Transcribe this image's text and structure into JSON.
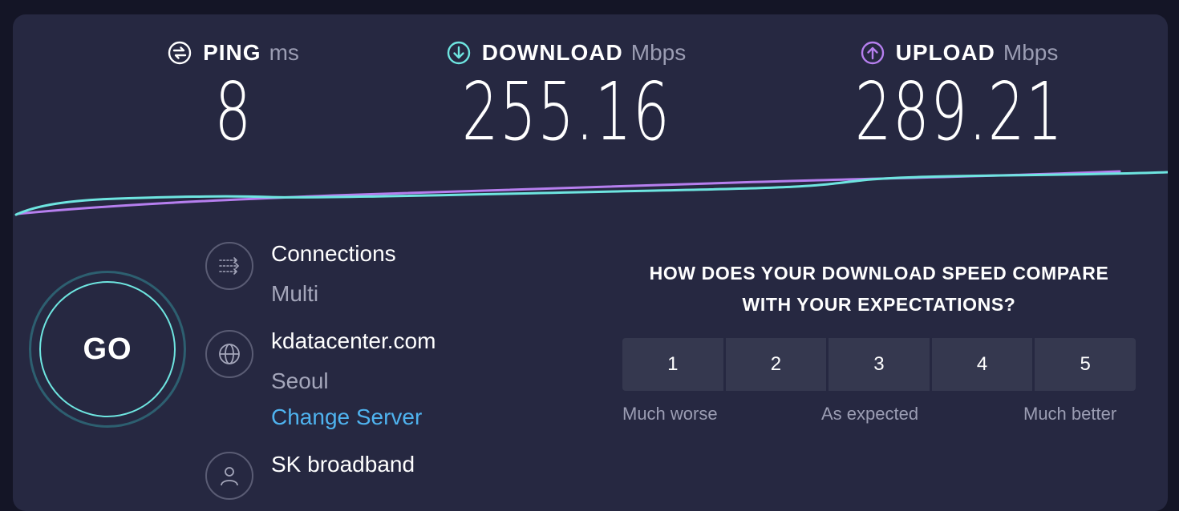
{
  "metrics": {
    "ping": {
      "label": "PING",
      "unit": "ms",
      "value": "8",
      "icon": "ping-icon",
      "color": "#ffffff"
    },
    "download": {
      "label": "DOWNLOAD",
      "unit": "Mbps",
      "value": "255.16",
      "icon": "download-arrow-icon",
      "color": "#6ee5e0"
    },
    "upload": {
      "label": "UPLOAD",
      "unit": "Mbps",
      "value": "289.21",
      "icon": "upload-arrow-icon",
      "color": "#b67fef"
    }
  },
  "go_button": {
    "label": "GO"
  },
  "connections": {
    "title": "Connections",
    "value": "Multi",
    "icon": "connections-icon"
  },
  "server": {
    "title": "kdatacenter.com",
    "location": "Seoul",
    "change_label": "Change Server",
    "icon": "globe-icon"
  },
  "provider": {
    "title": "SK broadband",
    "icon": "user-icon"
  },
  "survey": {
    "question_line1": "HOW DOES YOUR DOWNLOAD SPEED COMPARE",
    "question_line2": "WITH YOUR EXPECTATIONS?",
    "options": [
      "1",
      "2",
      "3",
      "4",
      "5"
    ],
    "low_label": "Much worse",
    "mid_label": "As expected",
    "high_label": "Much better"
  },
  "colors": {
    "background": "#141526",
    "panel": "#262841",
    "download_line": "#6ee5e0",
    "upload_line": "#b67fef",
    "link": "#4fb3ef"
  }
}
